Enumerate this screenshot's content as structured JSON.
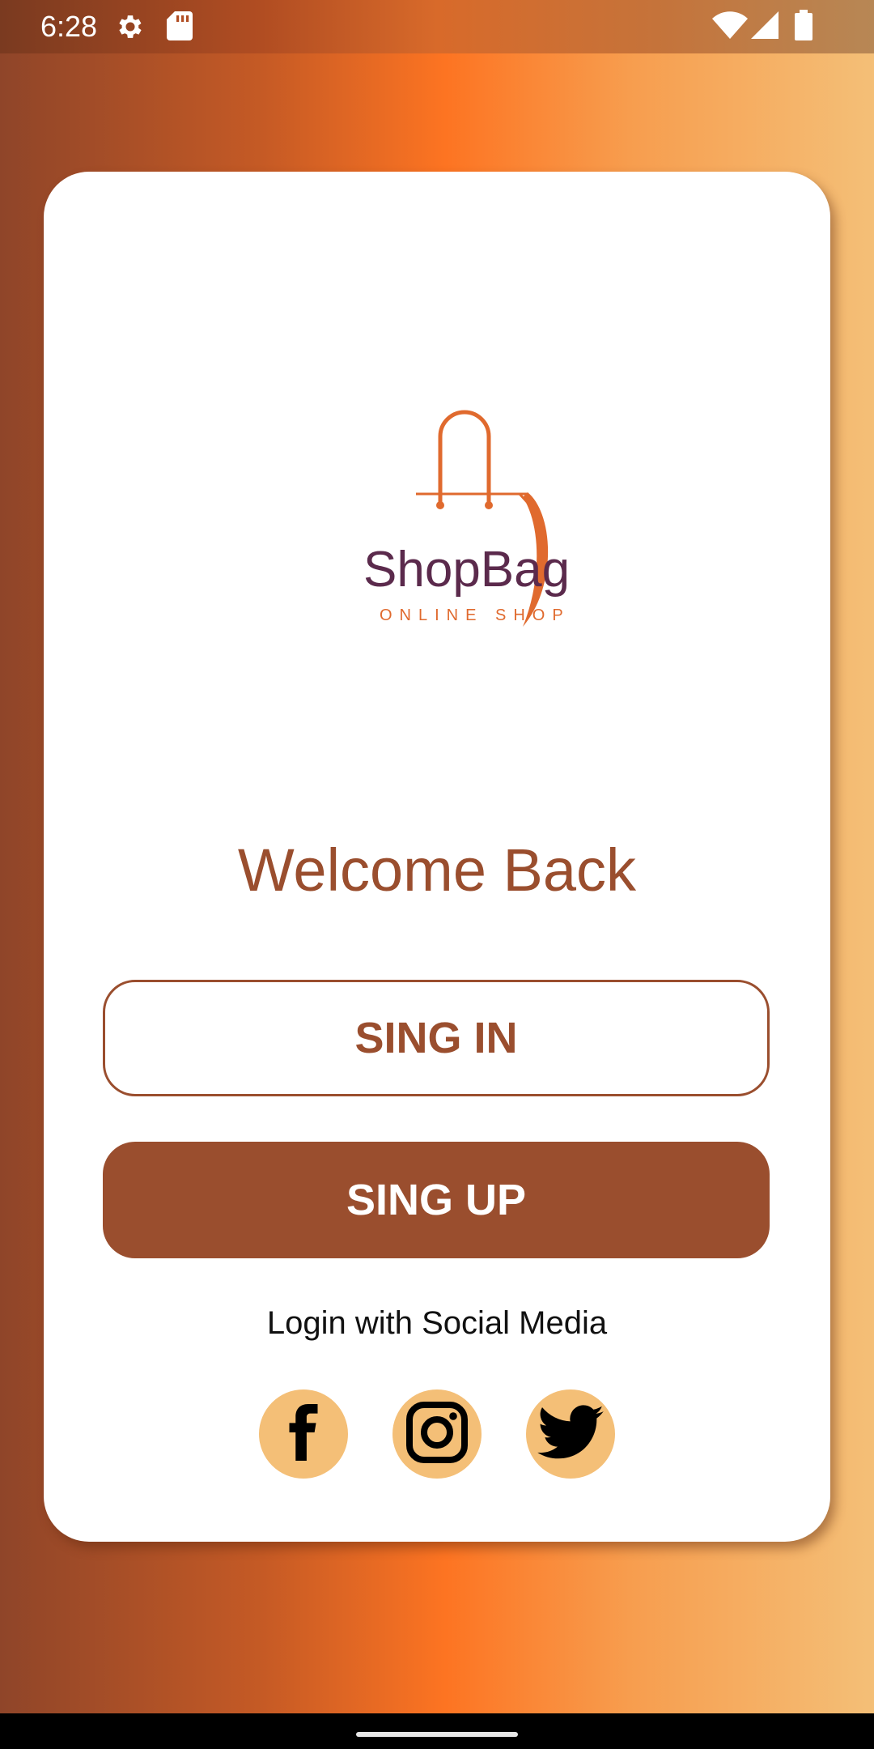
{
  "status_bar": {
    "time": "6:28",
    "icons": [
      "settings-icon",
      "sd-card-icon",
      "wifi-icon",
      "cellular-signal-icon",
      "battery-icon"
    ]
  },
  "logo": {
    "brand_name": "ShopBag",
    "tagline": "ONLINE SHOP"
  },
  "welcome": {
    "title": "Welcome Back"
  },
  "buttons": {
    "signin_label": "SING IN",
    "signup_label": "SING UP"
  },
  "social": {
    "label": "Login with Social Media",
    "icons": [
      "facebook-icon",
      "instagram-icon",
      "twitter-icon"
    ]
  },
  "colors": {
    "brand_brown": "#9a4e2e",
    "accent_orange": "#fd7422",
    "social_bg": "#f4bf77",
    "logo_purple": "#5b2a4c"
  }
}
